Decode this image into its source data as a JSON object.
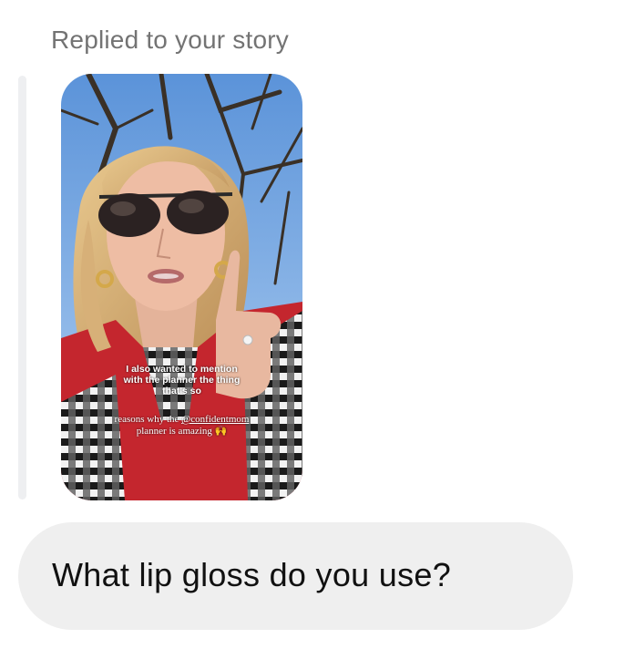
{
  "reply_header": "Replied to your story",
  "story": {
    "caption_lines": [
      "I also wanted to mention",
      "with the planner the thing",
      "that's so"
    ],
    "subcaption_prefix": "reasons why the ",
    "mention": "@confidentmom",
    "subcaption_line2": "planner is amazing 🙌"
  },
  "message": {
    "text": "What lip gloss do you use?"
  },
  "colors": {
    "header_text": "#737373",
    "bubble_bg": "#efefef",
    "message_text": "#111111",
    "reply_bar": "#eeeff1"
  }
}
